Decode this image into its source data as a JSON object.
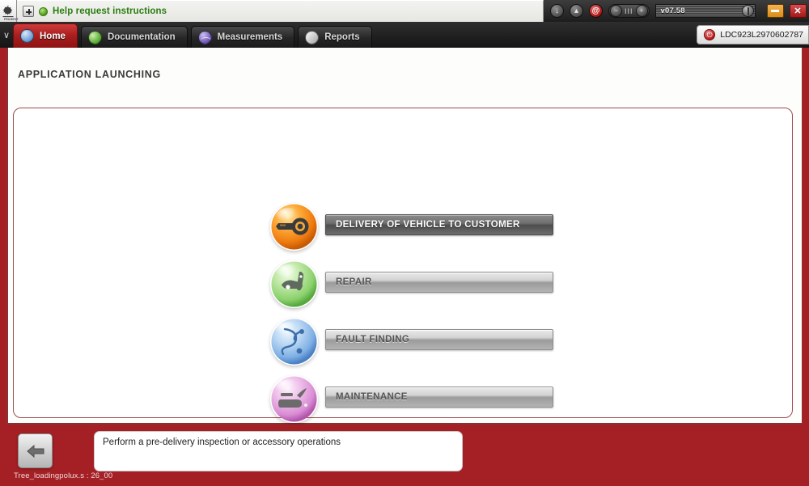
{
  "window": {
    "brand_logo": "peugeot-lion-logo",
    "brand_word": "PEUGEOT",
    "help": {
      "expand_icon": "plus-box-icon",
      "status_icon": "green-status-dot-icon",
      "text": "Help request instructions"
    },
    "tools": {
      "download_icon": "download-arrow-icon",
      "flame_icon": "flame-icon",
      "at_icon": "@",
      "pager": {
        "prev": "−",
        "mid": "III",
        "next": "+"
      },
      "version": "v07.58",
      "slider_knob_icon": "slider-knob-icon"
    },
    "controls": {
      "minimize_label": "–",
      "minimize_name": "minimize-button",
      "close_label": "✕",
      "close_name": "close-button"
    }
  },
  "tabs": {
    "chevron": "∨",
    "items": [
      {
        "label": "Home",
        "icon": "home-globe-icon",
        "active": true
      },
      {
        "label": "Documentation",
        "icon": "document-green-icon",
        "active": false
      },
      {
        "label": "Measurements",
        "icon": "waveform-icon",
        "active": false
      },
      {
        "label": "Reports",
        "icon": "report-page-icon",
        "active": false
      }
    ],
    "vehicle": {
      "power_icon": "power-icon",
      "vin": "LDC923L2970602787"
    }
  },
  "main": {
    "title": "APPLICATION LAUNCHING",
    "menu": [
      {
        "label": "DELIVERY OF VEHICLE TO CUSTOMER",
        "icon": "orange-key-orb-icon",
        "selected": true
      },
      {
        "label": "REPAIR",
        "icon": "green-wrench-orb-icon",
        "selected": false
      },
      {
        "label": "FAULT FINDING",
        "icon": "blue-stethoscope-orb-icon",
        "selected": false
      },
      {
        "label": "MAINTENANCE",
        "icon": "purple-oilcan-orb-icon",
        "selected": false
      }
    ]
  },
  "footer": {
    "back_icon": "back-arrow-icon",
    "hint": "Perform a pre-delivery inspection or accessory operations",
    "status": "Tree_loadingpolux.s : 26_00"
  },
  "colors": {
    "app_red": "#a52025",
    "tab_active": "#a81d1d",
    "help_green": "#2a7d10",
    "panel_border": "#9e4b4f"
  }
}
